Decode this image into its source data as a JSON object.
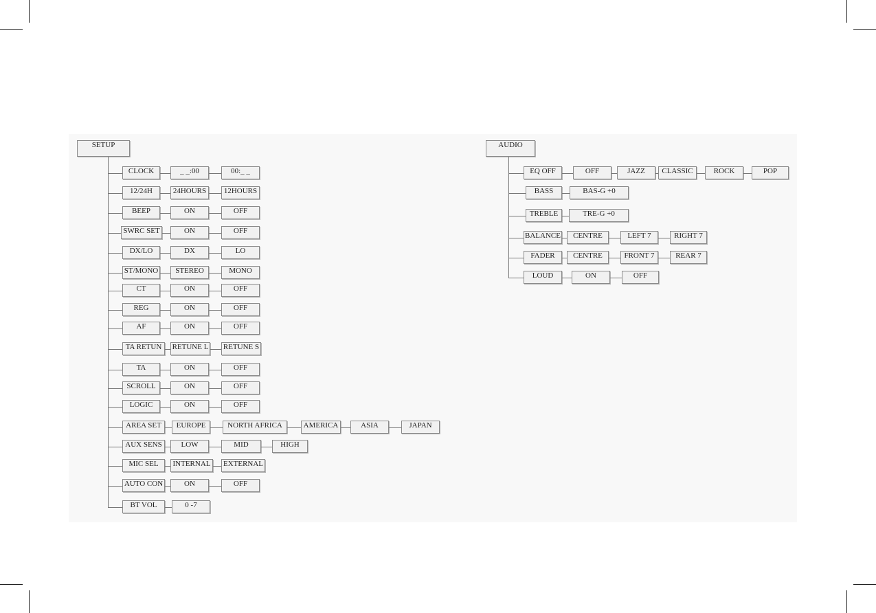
{
  "setup": {
    "title": "SETUP",
    "rows": [
      [
        "CLOCK",
        "_ _:00",
        "00:_ _"
      ],
      [
        "12/24H",
        "24HOURS",
        "12HOURS"
      ],
      [
        "BEEP",
        "ON",
        "OFF"
      ],
      [
        "SWRC SET",
        "ON",
        "OFF"
      ],
      [
        "DX/LO",
        "DX",
        "LO"
      ],
      [
        "ST/MONO",
        "STEREO",
        "MONO"
      ],
      [
        "CT",
        "ON",
        "OFF"
      ],
      [
        "REG",
        "ON",
        "OFF"
      ],
      [
        "AF",
        "ON",
        "OFF"
      ],
      [
        "TA RETUN",
        "RETUNE L",
        "RETUNE S"
      ],
      [
        "TA",
        "ON",
        "OFF"
      ],
      [
        "SCROLL",
        "ON",
        "OFF"
      ],
      [
        "LOGIC",
        "ON",
        "OFF"
      ],
      [
        "AREA SET",
        "EUROPE",
        "NORTH AFRICA",
        "AMERICA",
        "ASIA",
        "JAPAN"
      ],
      [
        "AUX SENS",
        "LOW",
        "MID",
        "HIGH"
      ],
      [
        "MIC SEL",
        "INTERNAL",
        "EXTERNAL"
      ],
      [
        "AUTO CON",
        "ON",
        "OFF"
      ],
      [
        "BT VOL",
        "0 -7"
      ]
    ]
  },
  "audio": {
    "title": "AUDIO",
    "rows": [
      [
        "EQ OFF",
        "OFF",
        "JAZZ",
        "CLASSIC",
        "ROCK",
        "POP"
      ],
      [
        "BASS",
        "BAS-G +0"
      ],
      [
        "TREBLE",
        "TRE-G +0"
      ],
      [
        "BALANCE",
        "CENTRE",
        "LEFT 7",
        "RIGHT 7"
      ],
      [
        "FADER",
        "CENTRE",
        "FRONT 7",
        "REAR 7"
      ],
      [
        "LOUD",
        "ON",
        "OFF"
      ]
    ]
  }
}
